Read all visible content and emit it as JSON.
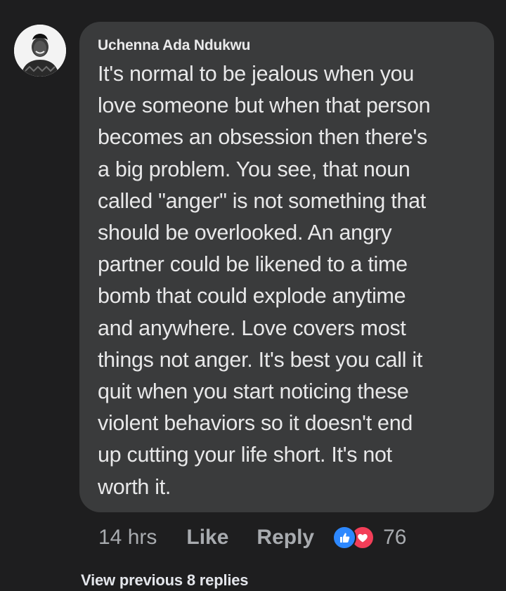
{
  "comment": {
    "author": "Uchenna Ada Ndukwu",
    "text": "It's normal to be jealous when you\nlove someone but when that person\nbecomes an obsession then there's\na big problem. You see, that noun\ncalled \"anger\" is not something that\nshould be overlooked. An angry\npartner could be likened to a time\nbomb that could explode anytime\nand anywhere. Love covers most\nthings not anger. It's best you call it\nquit when you start noticing these\nviolent behaviors so it doesn't end\nup cutting your life short. It's not\nworth it.",
    "avatar_icon": "user-avatar"
  },
  "actions": {
    "timestamp": "14 hrs",
    "like_label": "Like",
    "reply_label": "Reply",
    "reaction_icons": [
      "like-reaction-icon",
      "love-reaction-icon"
    ],
    "reaction_count": "76"
  },
  "replies": {
    "view_previous_label": "View previous 8 replies"
  },
  "colors": {
    "background": "#1e1e1f",
    "bubble": "#3a3b3c",
    "like_blue": "#2d88ff",
    "love_red": "#f33e58",
    "muted_text": "#a8abaf"
  }
}
